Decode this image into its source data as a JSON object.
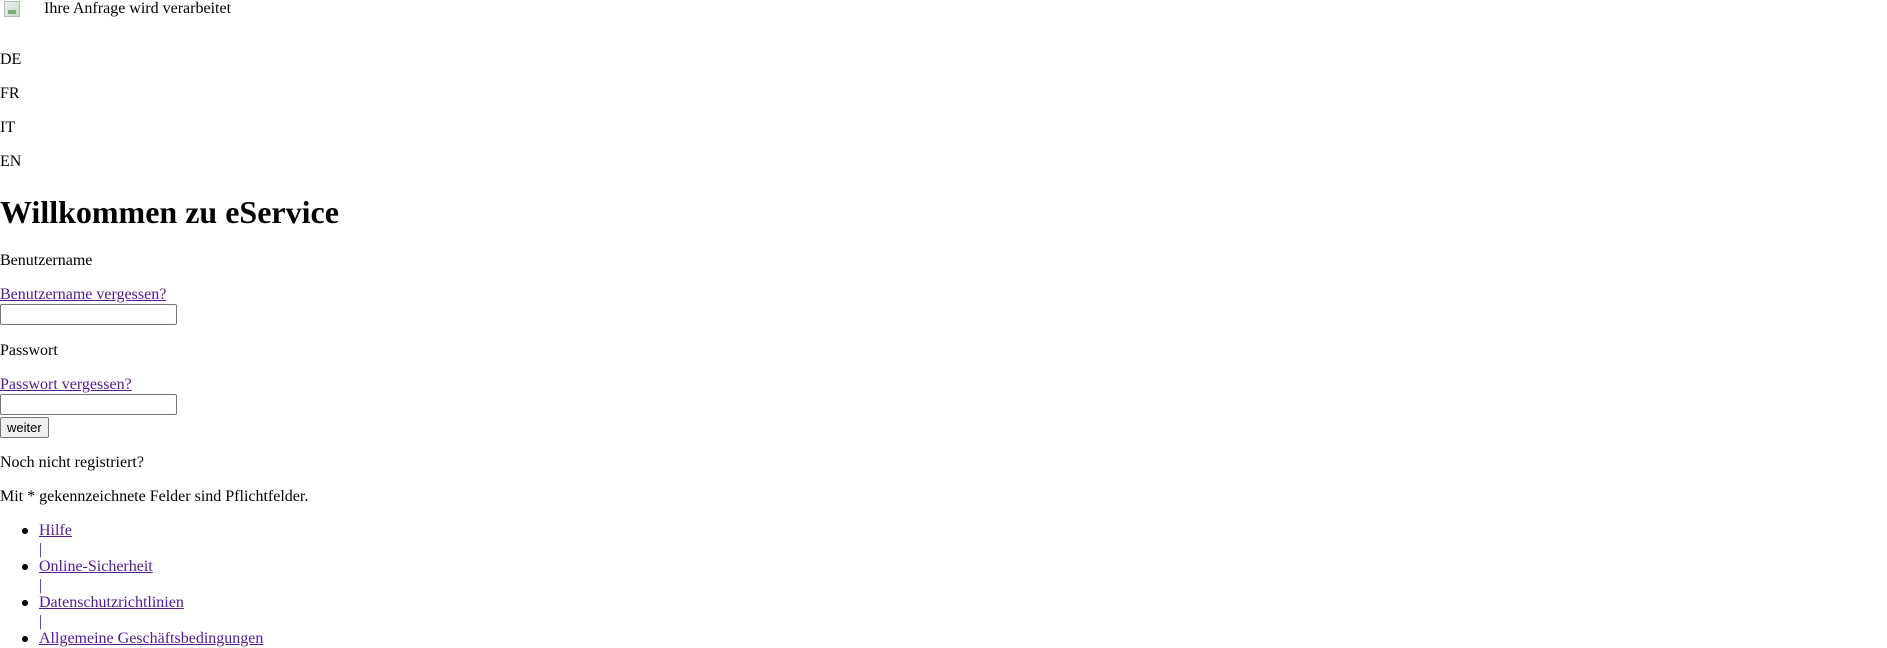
{
  "loading": {
    "image_icon": "broken-image-icon",
    "text": "Ihre Anfrage wird verarbeitet"
  },
  "languages": [
    "DE",
    "FR",
    "IT",
    "EN"
  ],
  "page_title": "Willkommen zu eService",
  "login": {
    "username_label": "Benutzername",
    "username_forgot": "Benutzername vergessen?",
    "username_value": "",
    "password_label": "Passwort",
    "password_forgot": "Passwort vergessen?",
    "password_value": "",
    "submit_label": "weiter"
  },
  "register_text": "Noch nicht registriert?",
  "required_note": "Mit * gekennzeichnete Felder sind Pflichtfelder.",
  "footer_links": [
    "Hilfe",
    "Online-Sicherheit",
    "Datenschutzrichtlinien",
    "Allgemeine Geschäftsbedingungen"
  ],
  "footer_separator": "|",
  "colors": {
    "visited_link": "#551a8b",
    "text": "#000000",
    "background": "#ffffff"
  }
}
